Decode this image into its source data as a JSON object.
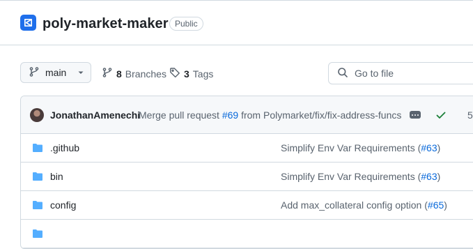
{
  "repo": {
    "name": "poly-market-maker",
    "visibility": "Public"
  },
  "toolbar": {
    "branch": "main",
    "branches_count": "8",
    "branches_label": "Branches",
    "tags_count": "3",
    "tags_label": "Tags",
    "goto_file_placeholder": "Go to file"
  },
  "latest_commit": {
    "author": "JonathanAmenechi",
    "message_prefix": "Merge pull request ",
    "pr": "#69",
    "message_suffix": " from Polymarket/fix/fix-address-funcs",
    "hash_partial": "5",
    "status": "success"
  },
  "files": [
    {
      "name": ".github",
      "message": "Simplify Env Var Requirements (",
      "pr": "#63",
      "tail": ")"
    },
    {
      "name": "bin",
      "message": "Simplify Env Var Requirements (",
      "pr": "#63",
      "tail": ")"
    },
    {
      "name": "config",
      "message": "Add max_collateral config option (",
      "pr": "#65",
      "tail": ")"
    },
    {
      "name": "",
      "message": "",
      "pr": "",
      "tail": ""
    }
  ],
  "icons": {
    "repo": "repo-logo-icon",
    "branch": "git-branch-icon",
    "tag": "tag-icon",
    "search": "search-icon",
    "folder": "folder-icon",
    "check": "check-icon",
    "ellipsis": "ellipsis-icon",
    "caret": "triangle-down-icon"
  },
  "colors": {
    "accent": "#1f6feb",
    "link": "#0969da",
    "folder": "#54aeff",
    "success": "#1a7f37"
  }
}
